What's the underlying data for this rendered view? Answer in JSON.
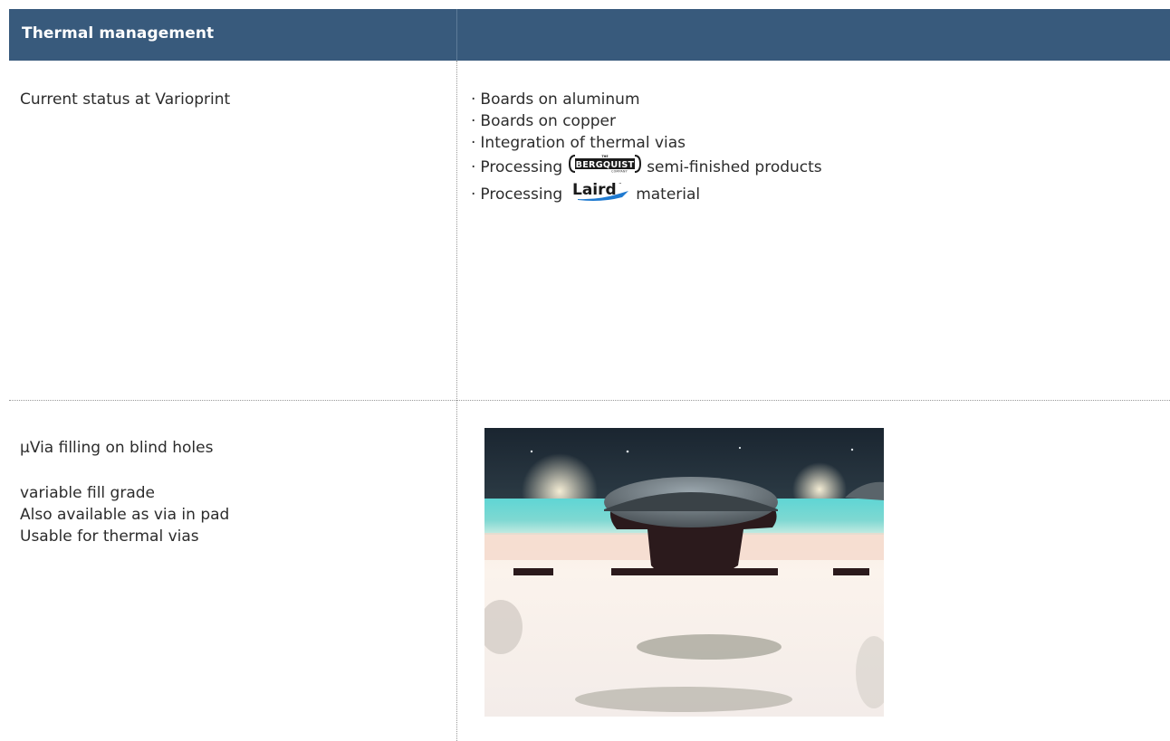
{
  "header": {
    "title": "Thermal management"
  },
  "rows": [
    {
      "label": "Current status at Varioprint",
      "items": [
        {
          "pre": "Boards on aluminum"
        },
        {
          "pre": "Boards on copper"
        },
        {
          "pre": "Integration of thermal vias"
        },
        {
          "pre": "Processing",
          "logo": "bergquist-logo",
          "post": "semi-finished products"
        },
        {
          "pre": "Processing",
          "logo": "laird-logo",
          "post": "material"
        }
      ]
    },
    {
      "title": "µVia filling on blind holes",
      "lines": [
        "variable fill grade",
        "Also available as via in pad",
        "Usable for thermal vias"
      ],
      "image": "microsection-photo"
    }
  ],
  "logos": {
    "bergquist": {
      "top": "THE",
      "main": "BERGQUIST",
      "bottom": "COMPANY"
    },
    "laird": {
      "main": "Laird"
    }
  },
  "colors": {
    "header_bg": "#385a7c",
    "header_text": "#ffffff",
    "body_text": "#2c2c2c",
    "divider": "#9a9a9a",
    "laird_blue": "#1f7ad0"
  }
}
